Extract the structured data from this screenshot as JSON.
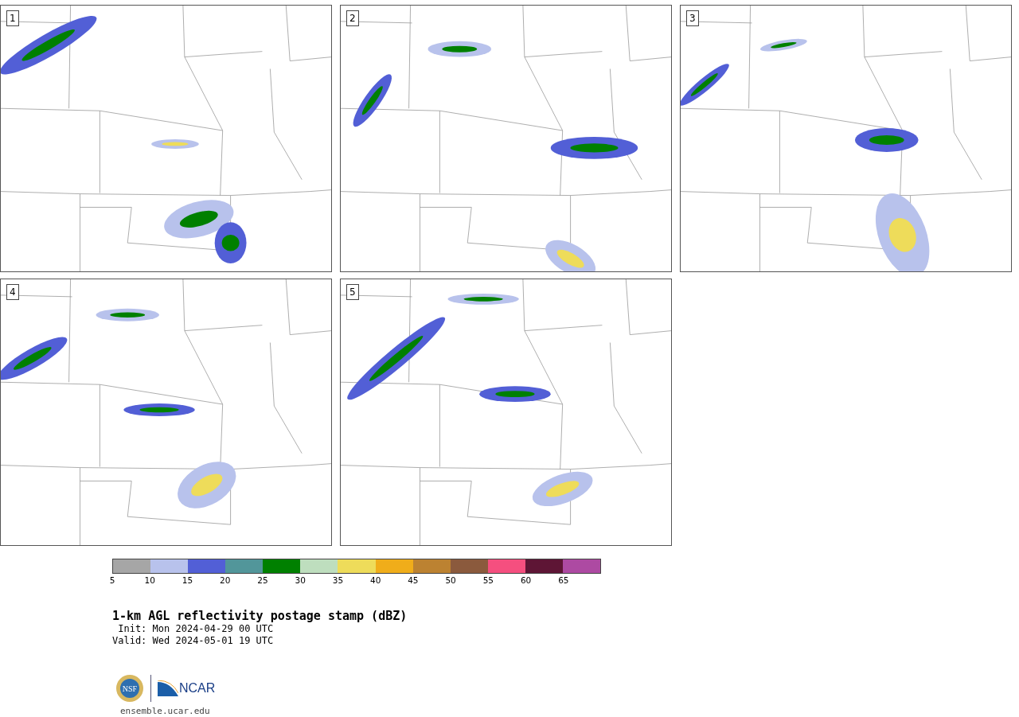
{
  "panels": [
    {
      "label": "1"
    },
    {
      "label": "2"
    },
    {
      "label": "3"
    },
    {
      "label": "4"
    },
    {
      "label": "5"
    }
  ],
  "colorbar": {
    "segments": [
      {
        "color": "#a6a6a6"
      },
      {
        "color": "#b8c2ec"
      },
      {
        "color": "#525fd6"
      },
      {
        "color": "#52969a"
      },
      {
        "color": "#008000"
      },
      {
        "color": "#bedebe"
      },
      {
        "color": "#eedc5a"
      },
      {
        "color": "#f0ad1a"
      },
      {
        "color": "#bc8231"
      },
      {
        "color": "#8b5a3d"
      },
      {
        "color": "#f54f7f"
      },
      {
        "color": "#5e1535"
      },
      {
        "color": "#ad4aa2"
      }
    ],
    "ticks": [
      "5",
      "10",
      "15",
      "20",
      "25",
      "30",
      "35",
      "40",
      "45",
      "50",
      "55",
      "60",
      "65"
    ]
  },
  "title": "1-km AGL reflectivity postage stamp (dBZ)",
  "init": " Init: Mon 2024-04-29 00 UTC",
  "valid": "Valid: Wed 2024-05-01 19 UTC",
  "logos": {
    "nsf": "NSF",
    "ncar": "NCAR"
  },
  "url": "ensemble.ucar.edu"
}
